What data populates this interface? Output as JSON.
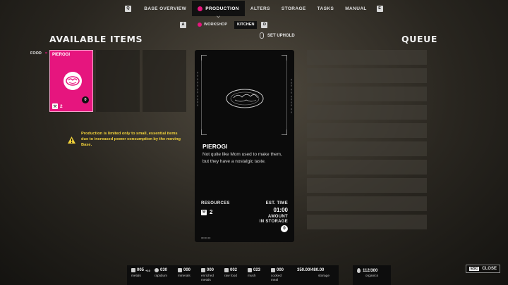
{
  "topnav": {
    "left_key": "Q",
    "right_key": "E",
    "tabs": [
      {
        "label": "BASE OVERVIEW",
        "active": false
      },
      {
        "label": "PRODUCTION",
        "active": true
      },
      {
        "label": "ALTERS",
        "active": false
      },
      {
        "label": "STORAGE",
        "active": false
      },
      {
        "label": "TASKS",
        "active": false
      },
      {
        "label": "MANUAL",
        "active": false
      }
    ]
  },
  "subnav": {
    "left_key": "A",
    "right_key": "D",
    "tabs": [
      {
        "label": "WORKSHOP",
        "active": false
      },
      {
        "label": "KITCHEN",
        "active": true
      }
    ],
    "set_uphold": "SET UPHOLD"
  },
  "available": {
    "title": "AVAILABLE ITEMS",
    "filter_label": "FOOD",
    "selected_item": {
      "name": "PIEROGI",
      "quantity": "0",
      "cost": "2"
    }
  },
  "queue": {
    "title": "QUEUE",
    "slots": 10
  },
  "warning": {
    "text": "Production is limited only to small, essential items due to increased power consumption by the moving Base."
  },
  "detail": {
    "title": "PIEROGI",
    "description": "Not quite like Mom used to make them, but they have a nostalgic taste.",
    "resources_label": "RESOURCES",
    "resource_cost": "2",
    "est_time_label": "EST. TIME",
    "est_time": "01:00",
    "amount_label": "AMOUNT\nIN STORAGE",
    "amount": "0"
  },
  "bottom": {
    "resources": [
      {
        "value": "005",
        "extra": "+10",
        "name": "metals",
        "icon": "metals-icon"
      },
      {
        "value": "030",
        "extra": "",
        "name": "rapidium",
        "icon": "rapidium-icon"
      },
      {
        "value": "000",
        "extra": "",
        "name": "minerals",
        "icon": "minerals-icon"
      },
      {
        "value": "000",
        "extra": "",
        "name": "enriched\nmetals",
        "icon": "enriched-metals-icon"
      },
      {
        "value": "002",
        "extra": "",
        "name": "raw food",
        "icon": "raw-food-icon"
      },
      {
        "value": "023",
        "extra": "",
        "name": "mush",
        "icon": "mush-icon"
      },
      {
        "value": "000",
        "extra": "",
        "name": "cooked\nmeal",
        "icon": "cooked-meal-icon"
      }
    ],
    "storage": {
      "value": "350.00/480.00",
      "name": "storage"
    },
    "organics": {
      "value": "112/300",
      "name": "organics"
    }
  },
  "close": {
    "key": "ESC",
    "label": "CLOSE"
  },
  "colors": {
    "accent": "#e6157e",
    "warning": "#f2d23a"
  }
}
